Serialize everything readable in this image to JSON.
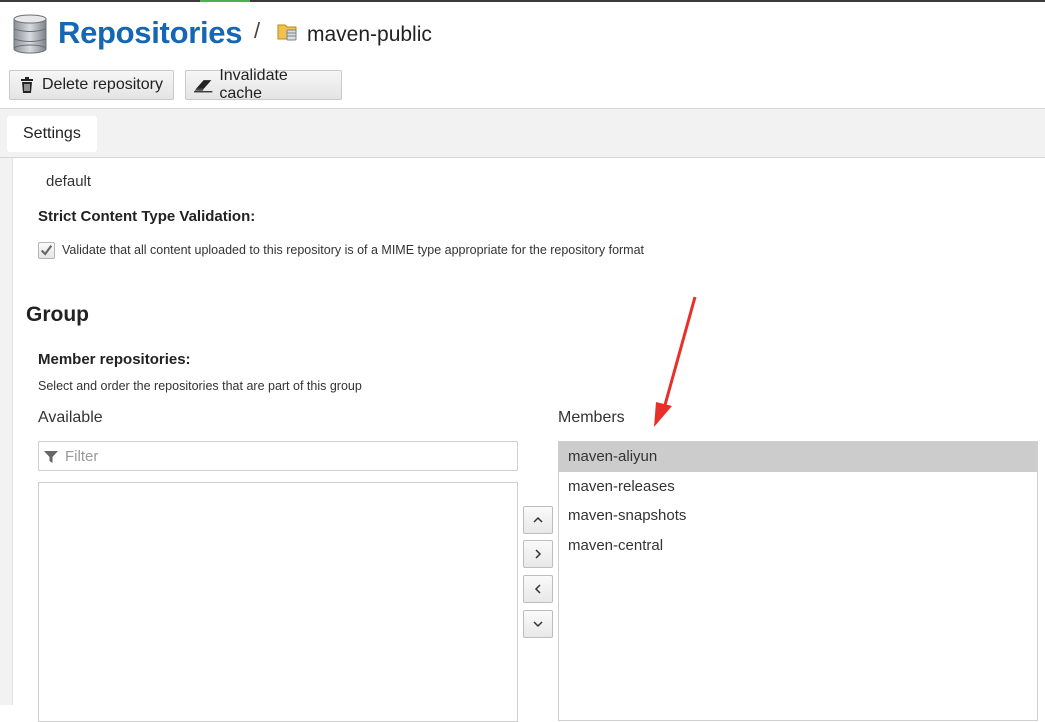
{
  "header": {
    "title": "Repositories",
    "separator": "/",
    "repo_name": "maven-public"
  },
  "toolbar": {
    "delete_label": "Delete repository",
    "invalidate_label": "Invalidate cache"
  },
  "tabs": [
    {
      "label": "Settings"
    }
  ],
  "settings": {
    "blob_store_value": "default",
    "strict_label": "Strict Content Type Validation:",
    "strict_checked": true,
    "strict_text": "Validate that all content uploaded to this repository is of a MIME type appropriate for the repository format"
  },
  "group": {
    "heading": "Group",
    "member_label": "Member repositories:",
    "member_help": "Select and order the repositories that are part of this group",
    "available_label": "Available",
    "members_label": "Members",
    "filter_placeholder": "Filter",
    "available": [],
    "members": [
      {
        "name": "maven-aliyun",
        "selected": true
      },
      {
        "name": "maven-releases",
        "selected": false
      },
      {
        "name": "maven-snapshots",
        "selected": false
      },
      {
        "name": "maven-central",
        "selected": false
      }
    ]
  },
  "icons": {
    "header": "database-icon",
    "repo": "folder-repo-icon",
    "delete": "trash-icon",
    "invalidate": "eraser-icon",
    "filter": "filter-icon",
    "move_up": "chevron-up-icon",
    "add": "chevron-right-icon",
    "remove": "chevron-left-icon",
    "move_down": "chevron-down-icon",
    "annotation": "red-arrow-annotation"
  },
  "colors": {
    "title": "#1667b3",
    "selected_row": "#cccccc",
    "annotation": "#e8302a"
  }
}
